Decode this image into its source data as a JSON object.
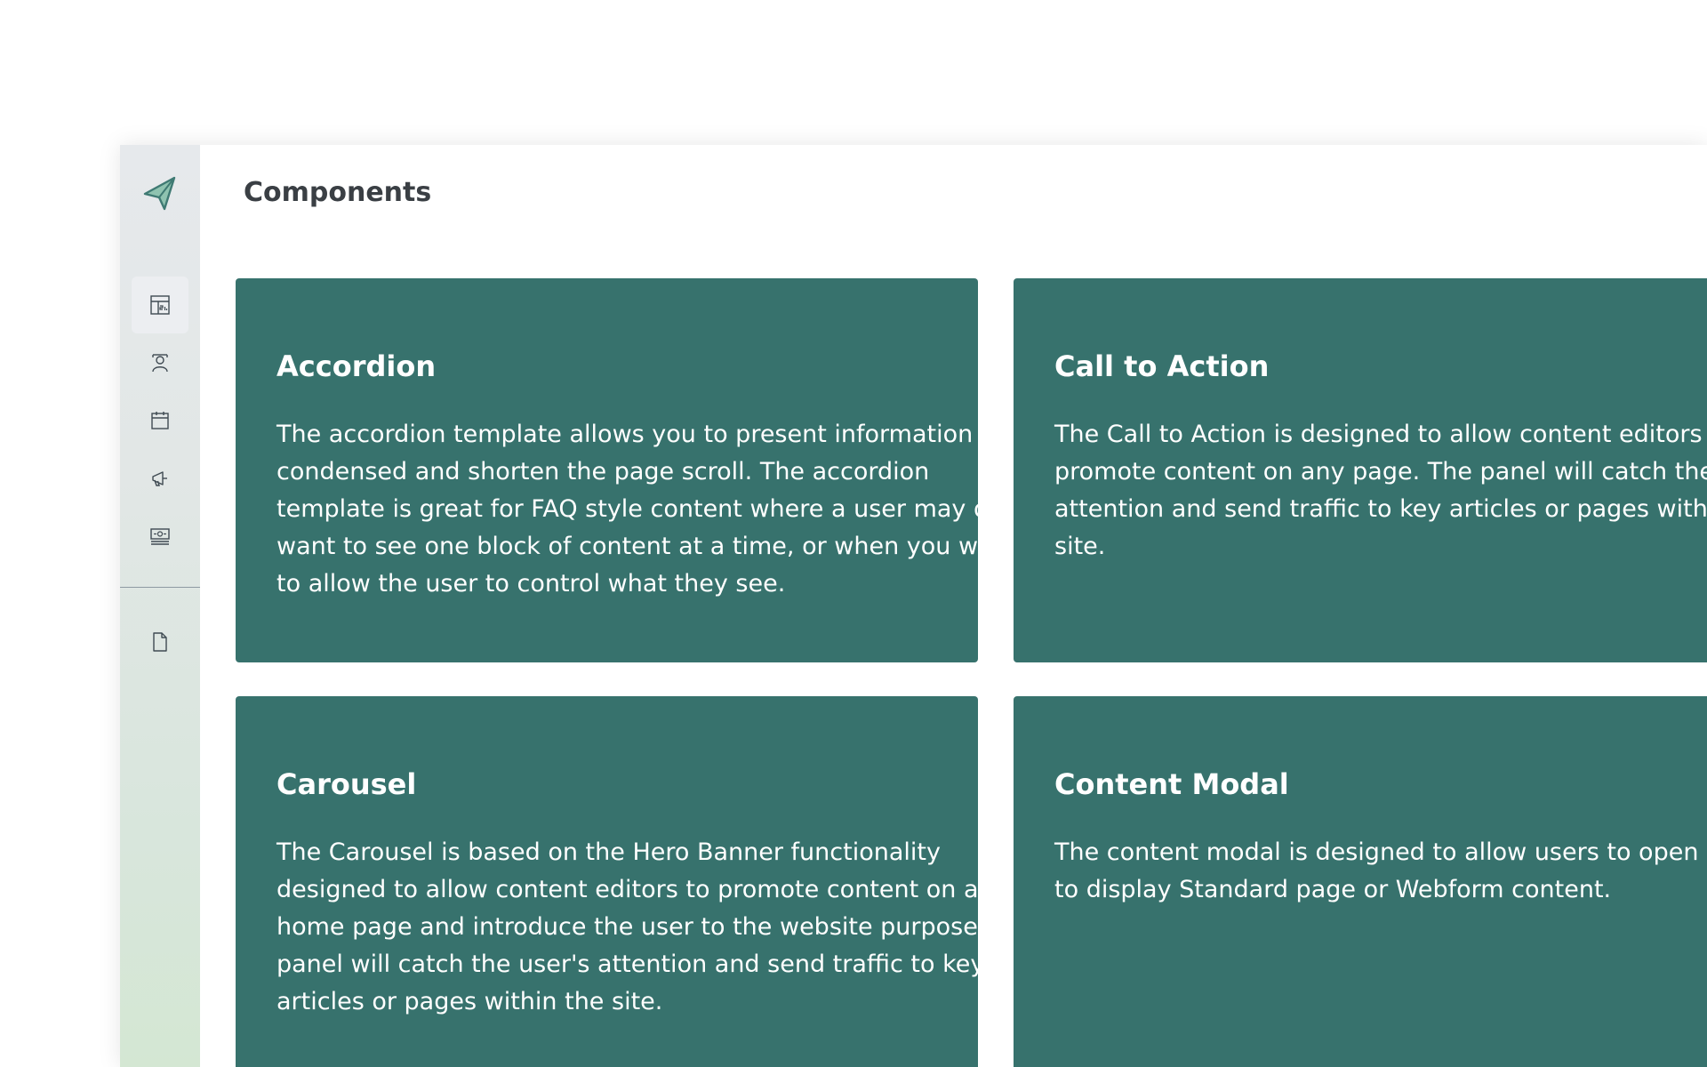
{
  "page": {
    "title": "Components"
  },
  "sidebar": {
    "logo": "paper-plane-logo-icon",
    "items": [
      {
        "icon": "dashboard-icon",
        "active": true
      },
      {
        "icon": "people-icon",
        "active": false
      },
      {
        "icon": "calendar-icon",
        "active": false
      },
      {
        "icon": "megaphone-icon",
        "active": false
      },
      {
        "icon": "banner-icon",
        "active": false
      },
      {
        "icon": "document-icon",
        "active": false
      }
    ]
  },
  "cards": [
    {
      "title": "Accordion",
      "lines": [
        "The accordion template allows you to present information",
        "condensed and shorten the page scroll. The accordion",
        "template is great for FAQ style content where a user may only",
        "want to see one block of content at a time, or when you want",
        "to allow the user to control what they see."
      ]
    },
    {
      "title": "Call to Action",
      "lines": [
        "The Call to Action is designed to allow content editors to",
        "promote content on any page. The panel will catch the user's",
        "attention and send traffic to key articles or pages within the",
        "site."
      ]
    },
    {
      "title": "Carousel",
      "lines": [
        "The Carousel is based on the Hero Banner functionality",
        "designed to allow content editors to promote content on a",
        "home page and introduce the user to the website purpose. The",
        "panel will catch the user's attention and send traffic to key",
        "articles or pages within the site."
      ]
    },
    {
      "title": "Content Modal",
      "lines": [
        "The content modal is designed to allow users to open a modal",
        "to display Standard page or Webform content."
      ]
    }
  ],
  "colors": {
    "card_background": "#37726d",
    "title_text": "#3a3f44",
    "logo_fill": "#8fc3b0",
    "logo_stroke": "#3f7a73"
  }
}
